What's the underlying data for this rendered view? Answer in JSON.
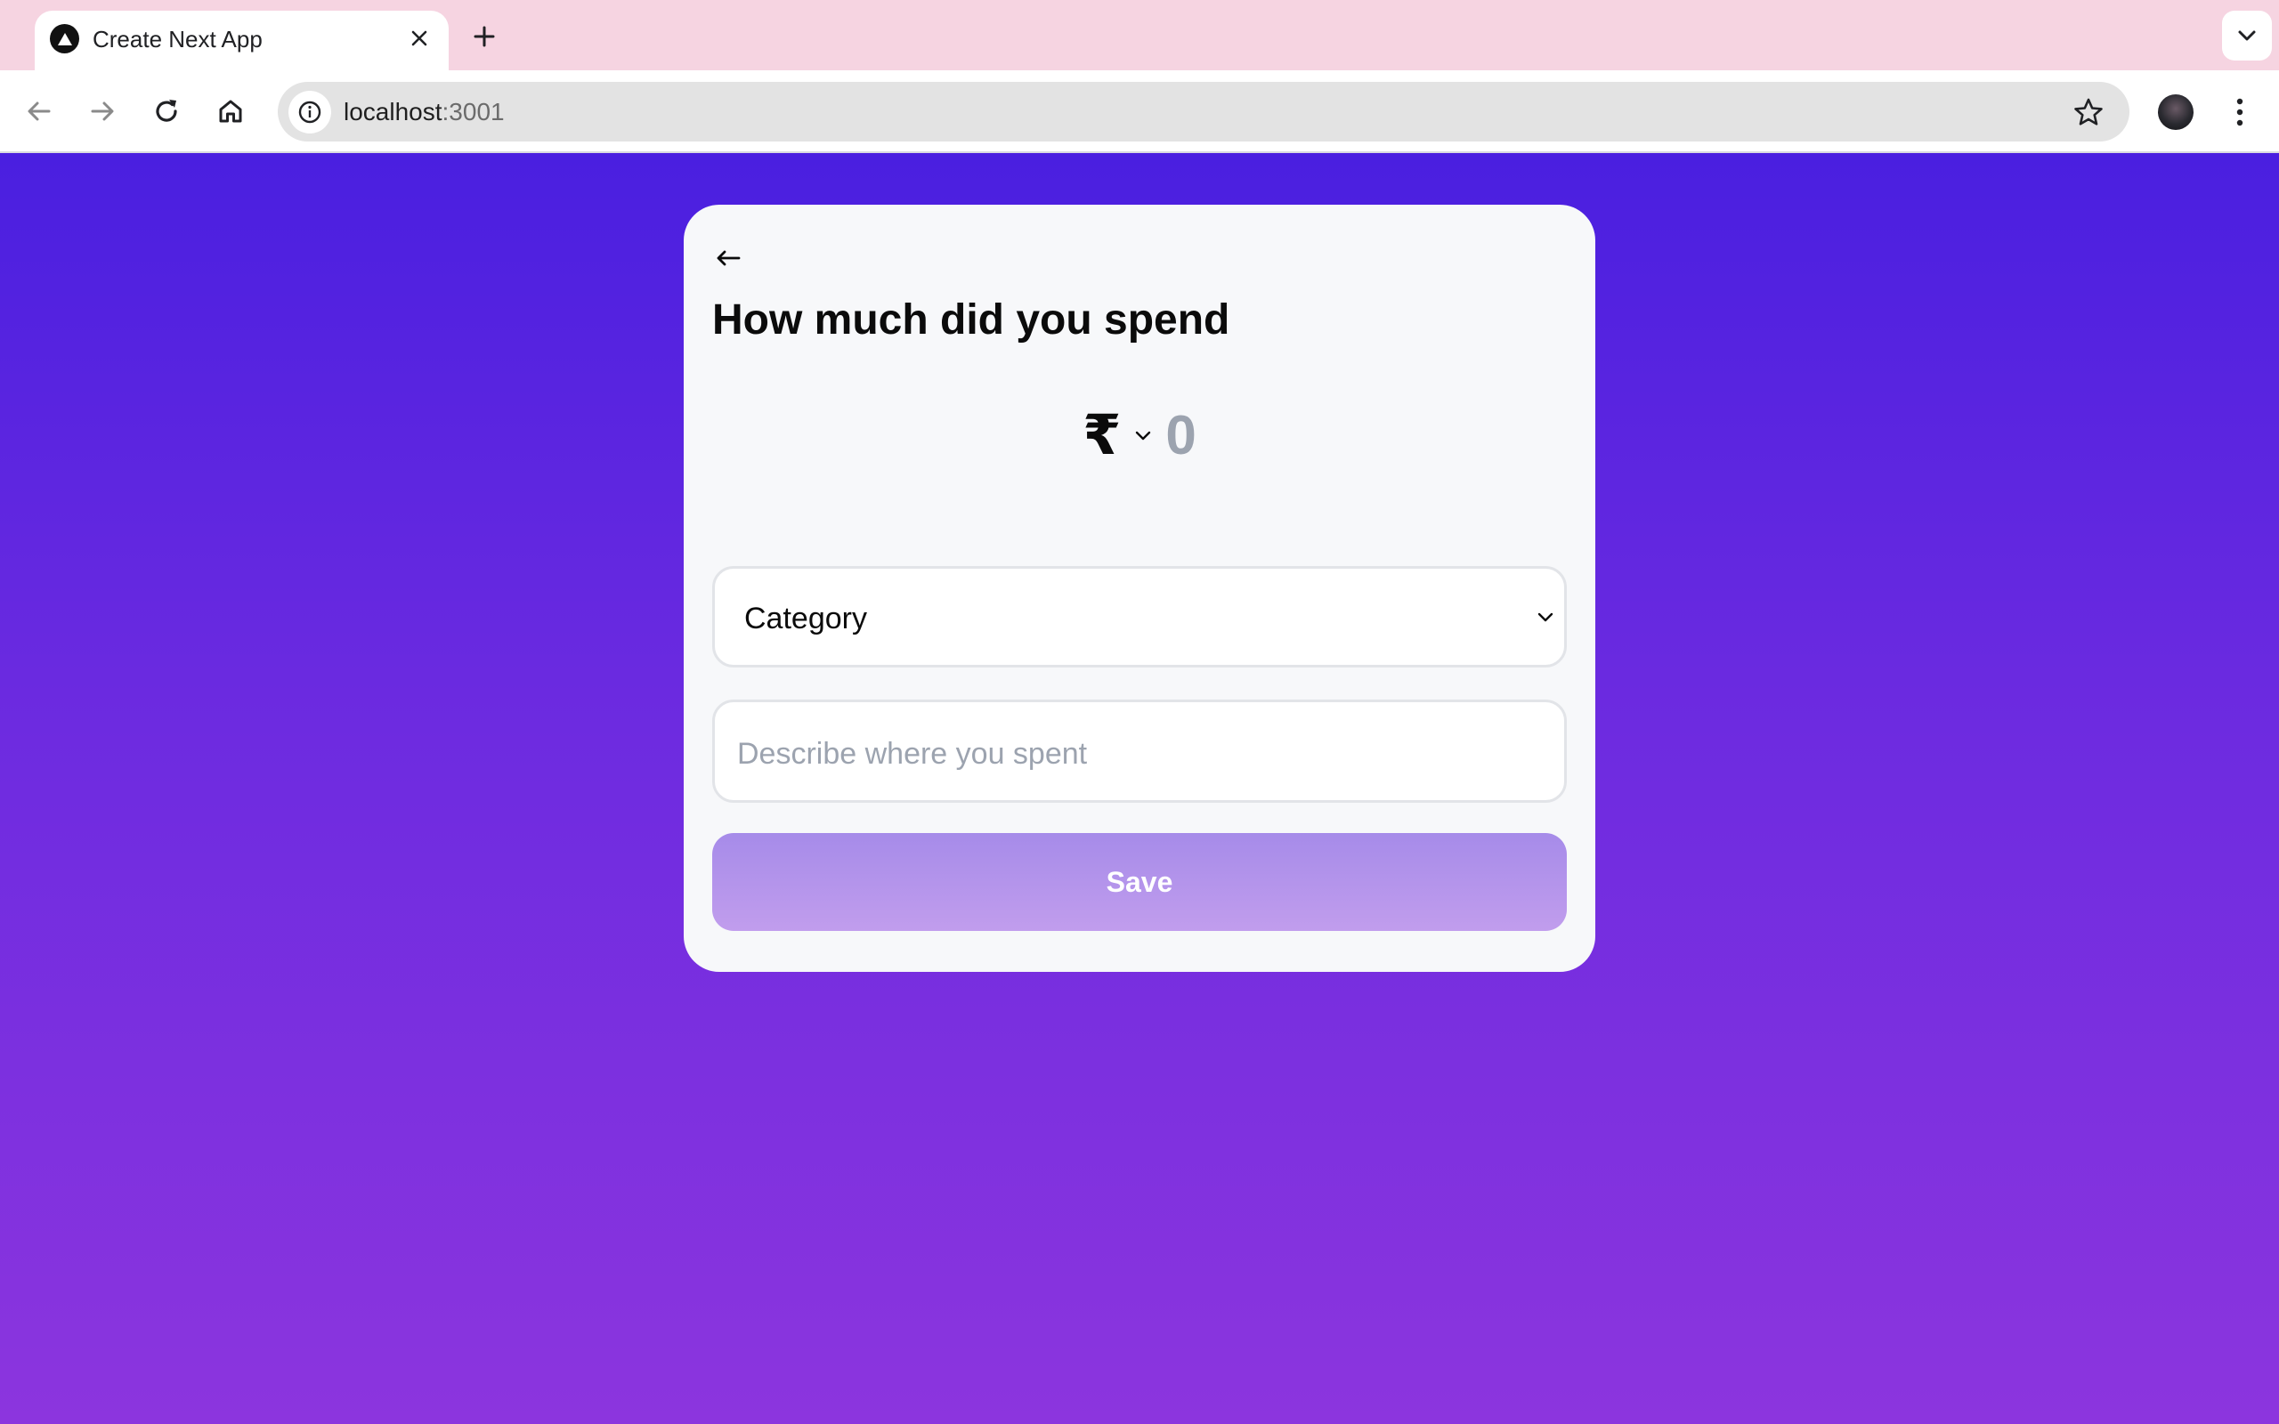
{
  "browser": {
    "tab_title": "Create Next App",
    "url_host": "localhost",
    "url_port": ":3001"
  },
  "form": {
    "heading": "How much did you spend",
    "currency_symbol": "₹",
    "amount": "0",
    "category_label": "Category",
    "description_placeholder": "Describe where you spent",
    "save_label": "Save"
  },
  "colors": {
    "gradient_top": "#4a1fe0",
    "gradient_bottom": "#8c35de",
    "save_button": "#b393eb",
    "tabstrip": "#f6d4e1"
  },
  "icons": {
    "favicon": "nextjs-triangle-icon",
    "back": "arrow-left-icon",
    "currency_toggle": "chevron-down-icon",
    "select": "chevron-down-icon"
  }
}
